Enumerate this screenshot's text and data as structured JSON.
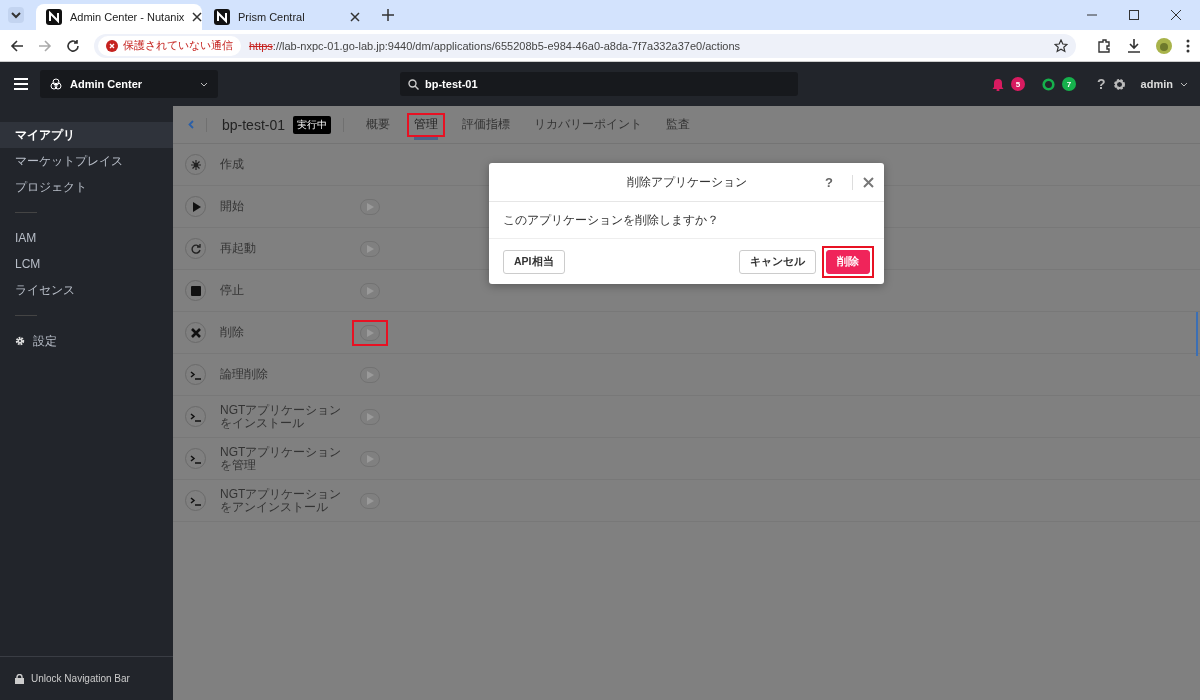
{
  "browser": {
    "tabs": [
      {
        "title": "Admin Center - Nutanix",
        "selected": true
      },
      {
        "title": "Prism Central",
        "selected": false
      }
    ],
    "security_label": "保護されていない通信",
    "url_scheme": "https",
    "url_rest": "://lab-nxpc-01.go-lab.jp:9440/dm/applications/655208b5-e984-46a0-a8da-7f7a332a37e0/actions"
  },
  "header": {
    "app_switcher": "Admin Center",
    "search_value": "bp-test-01",
    "alerts_count": "5",
    "tasks_count": "7",
    "help": "?",
    "user": "admin"
  },
  "sidebar": {
    "groups": [
      [
        {
          "label": "マイアプリ",
          "selected": true
        },
        {
          "label": "マーケットプレイス",
          "selected": false
        },
        {
          "label": "プロジェクト",
          "selected": false
        }
      ],
      [
        {
          "label": "IAM",
          "selected": false
        },
        {
          "label": "LCM",
          "selected": false
        },
        {
          "label": "ライセンス",
          "selected": false
        }
      ],
      [
        {
          "label": "設定",
          "selected": false,
          "kind": "gear"
        }
      ]
    ],
    "footer": "Unlock Navigation Bar"
  },
  "app": {
    "name": "bp-test-01",
    "status": "実行中",
    "tabs": [
      {
        "label": "概要",
        "selected": false,
        "highlighted": false
      },
      {
        "label": "管理",
        "selected": true,
        "highlighted": true
      },
      {
        "label": "評価指標",
        "selected": false,
        "highlighted": false
      },
      {
        "label": "リカバリーポイント",
        "selected": false,
        "highlighted": false
      },
      {
        "label": "監査",
        "selected": false,
        "highlighted": false
      }
    ]
  },
  "actions": [
    {
      "label": "作成",
      "kind": "create",
      "run_button": false,
      "highlighted": false
    },
    {
      "label": "開始",
      "kind": "play",
      "run_button": true,
      "highlighted": false
    },
    {
      "label": "再起動",
      "kind": "restart",
      "run_button": true,
      "highlighted": false
    },
    {
      "label": "停止",
      "kind": "stop",
      "run_button": true,
      "highlighted": false
    },
    {
      "label": "削除",
      "kind": "delete",
      "run_button": true,
      "highlighted": true
    },
    {
      "label": "論理削除",
      "kind": "terminal",
      "run_button": true,
      "highlighted": false
    },
    {
      "label": "NGTアプリケーションをインストール",
      "kind": "terminal",
      "run_button": true,
      "highlighted": false
    },
    {
      "label": "NGTアプリケーションを管理",
      "kind": "terminal",
      "run_button": true,
      "highlighted": false
    },
    {
      "label": "NGTアプリケーションをアンインストール",
      "kind": "terminal",
      "run_button": true,
      "highlighted": false
    }
  ],
  "dialog": {
    "title": "削除アプリケーション",
    "help": "?",
    "message": "このアプリケーションを削除しますか？",
    "buttons": [
      {
        "label": "API相当",
        "kind": "secondary",
        "highlighted": false
      },
      {
        "label": "キャンセル",
        "kind": "secondary",
        "highlighted": false
      },
      {
        "label": "削除",
        "kind": "danger",
        "highlighted": true
      }
    ]
  }
}
